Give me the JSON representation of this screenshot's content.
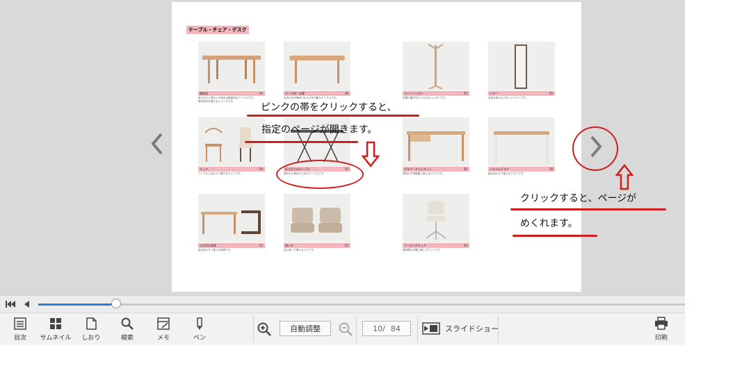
{
  "page": {
    "section_title": "テーブル・チェア・デスク",
    "products": [
      {
        "name": "無垢材",
        "page": "44",
        "desc1": "使うほどに味わいが深まる無垢材のテーブルです。",
        "desc2": "脚の形状を選べるシリーズです。"
      },
      {
        "name": "オーク材・丸脚",
        "page": "46",
        "desc1": "丸みのある脚がやわらかな印象のテーブルです。",
        "desc2": ""
      },
      {
        "name": "コートハンガー",
        "page": "55",
        "desc1": "衣類や帽子をかけられるハンガーです。",
        "desc2": ""
      },
      {
        "name": "ミラー",
        "page": "55",
        "desc1": "全身を映せるスタンドミラーです。",
        "desc2": ""
      },
      {
        "name": "チェア",
        "page": "50",
        "desc1": "テーブルに合わせて選べるチェアです。",
        "desc2": ""
      },
      {
        "name": "折りたたみテーブル",
        "page": "52",
        "desc1": "使わない時はたためるテーブルです。",
        "desc2": ""
      },
      {
        "name": "デスク・キャビネット",
        "page": "56",
        "desc1": "書斎や子供部屋に使えるデスクです。",
        "desc2": ""
      },
      {
        "name": "システムデスク",
        "page": "58",
        "desc1": "組み合わせて使えるデスクです。",
        "desc2": ""
      },
      {
        "name": "コの字の家具",
        "page": "53",
        "desc1": "組み合わせて使える家具です。",
        "desc2": ""
      },
      {
        "name": "座いす",
        "page": "53",
        "desc1": "床に座って使えるいすです。",
        "desc2": ""
      },
      {
        "name": "ワーキングチェア",
        "page": "59",
        "desc1": "長時間の作業に適したチェアです。",
        "desc2": ""
      }
    ]
  },
  "annotations": {
    "pink_band_line1": "ピンクの帯をクリックすると、",
    "pink_band_line2": "指定のページが開きます。",
    "next_line1": "クリックすると、ページが",
    "next_line2": "めくれます。"
  },
  "navigation": {
    "prev_icon": "chevron-left-icon",
    "next_icon": "chevron-right-icon"
  },
  "progress": {
    "fraction": 0.12
  },
  "toolbar": {
    "toc": "目次",
    "thumbnails": "サムネイル",
    "bookmark": "しおり",
    "search": "検索",
    "memo": "メモ",
    "pen": "ペン",
    "auto_fit": "自動調整",
    "page_current": "10/",
    "page_total": "84",
    "slideshow": "スライドショー",
    "print": "印刷"
  },
  "colors": {
    "pink_band": "#f3b6bd",
    "annotation_red": "#d01c1c",
    "progress_blue": "#2a7fd4"
  }
}
